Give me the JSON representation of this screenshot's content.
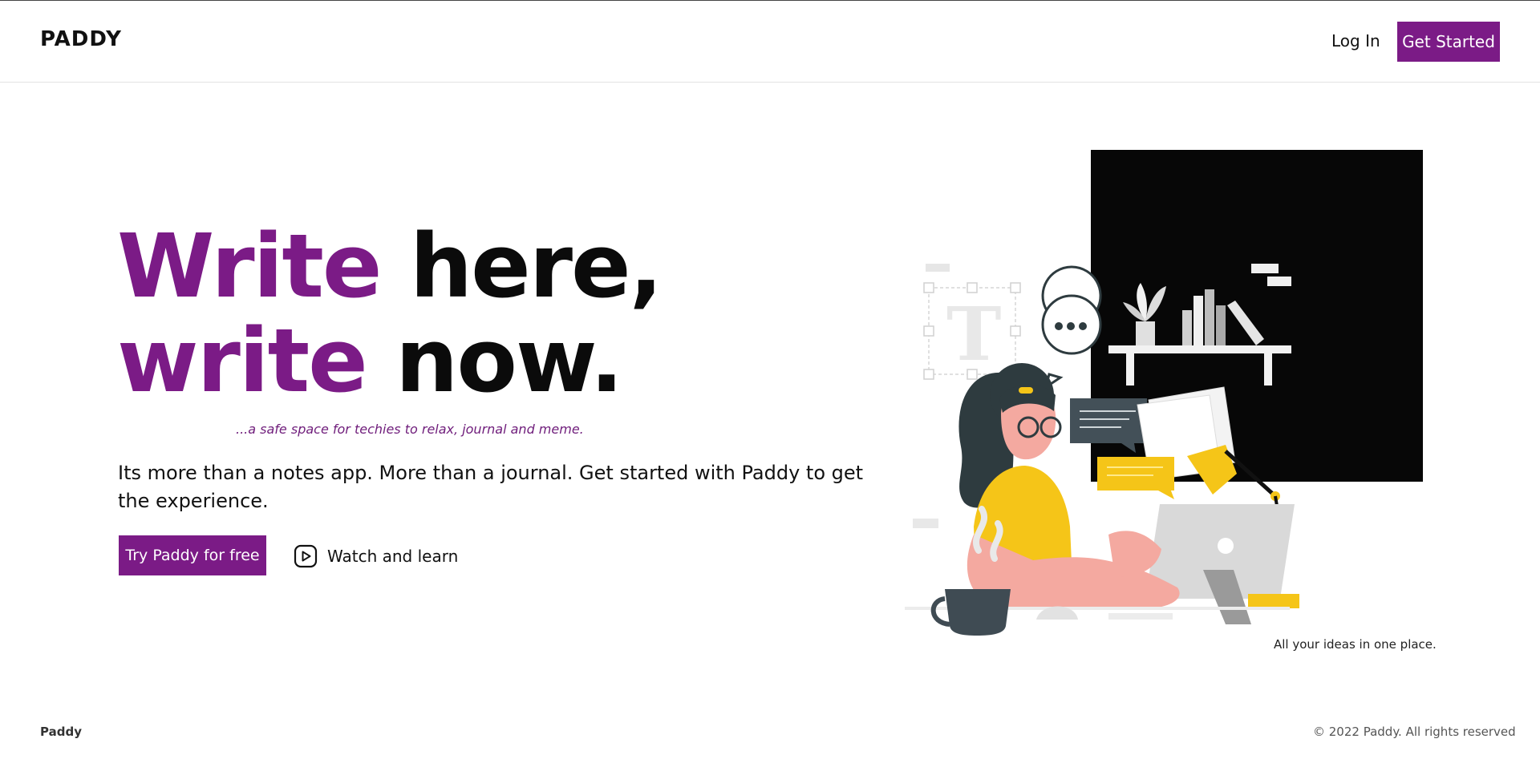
{
  "header": {
    "brand": "PADDY",
    "login_label": "Log In",
    "get_started_label": "Get Started"
  },
  "hero": {
    "title_line1_accent": "Write",
    "title_line1_rest": " here,",
    "title_line2_accent": "write",
    "title_line2_rest": " now.",
    "tagline": "...a safe space for techies to relax, journal and meme.",
    "lead": "Its more than a notes app. More than a journal. Get started with Paddy to get the experience.",
    "primary_cta": "Try Paddy for free",
    "secondary_cta": "Watch and learn",
    "secondary_cta_icon": "play-circle-icon"
  },
  "illustration": {
    "caption": "All your ideas in one place."
  },
  "footer": {
    "brand": "Paddy",
    "copyright": "© 2022 Paddy. All rights reserved"
  },
  "colors": {
    "accent": "#7b1b86",
    "dark": "#0b0b0b",
    "yellow": "#f5c518",
    "skin": "#f4a9a0",
    "hair": "#2e3b3f"
  }
}
